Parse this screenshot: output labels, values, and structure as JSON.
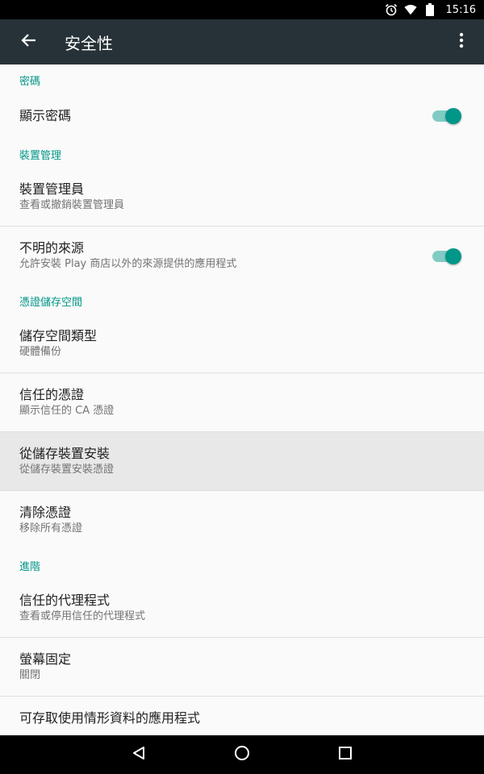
{
  "status_bar": {
    "time": "15:16",
    "icons": [
      "alarm-icon",
      "wifi-icon",
      "battery-icon"
    ]
  },
  "app_bar": {
    "title": "安全性",
    "back_icon": "arrow-back-icon",
    "more_icon": "more-vert-icon"
  },
  "sections": {
    "password": {
      "header": "密碼",
      "show_password": {
        "title": "顯示密碼",
        "switch_on": true
      }
    },
    "device_admin": {
      "header": "裝置管理",
      "admins": {
        "title": "裝置管理員",
        "summary": "查看或撤銷裝置管理員"
      },
      "unknown_sources": {
        "title": "不明的來源",
        "summary": "允許安裝 Play 商店以外的來源提供的應用程式",
        "switch_on": true
      }
    },
    "credential_storage": {
      "header": "憑證儲存空間",
      "storage_type": {
        "title": "儲存空間類型",
        "summary": "硬體備份"
      },
      "trusted_credentials": {
        "title": "信任的憑證",
        "summary": "顯示信任的 CA 憑證"
      },
      "install_from_storage": {
        "title": "從儲存裝置安裝",
        "summary": "從儲存裝置安裝憑證"
      },
      "clear_credentials": {
        "title": "清除憑證",
        "summary": "移除所有憑證"
      }
    },
    "advanced": {
      "header": "進階",
      "trust_agents": {
        "title": "信任的代理程式",
        "summary": "查看或停用信任的代理程式"
      },
      "screen_pinning": {
        "title": "螢幕固定",
        "summary": "關閉"
      },
      "usage_access": {
        "title": "可存取使用情形資料的應用程式"
      }
    }
  },
  "nav_bar": {
    "icons": [
      "back-triangle-icon",
      "home-circle-icon",
      "recents-square-icon"
    ]
  },
  "colors": {
    "accent": "#009688",
    "app_bar": "#263238",
    "highlight_row": "#e8e8e8"
  }
}
